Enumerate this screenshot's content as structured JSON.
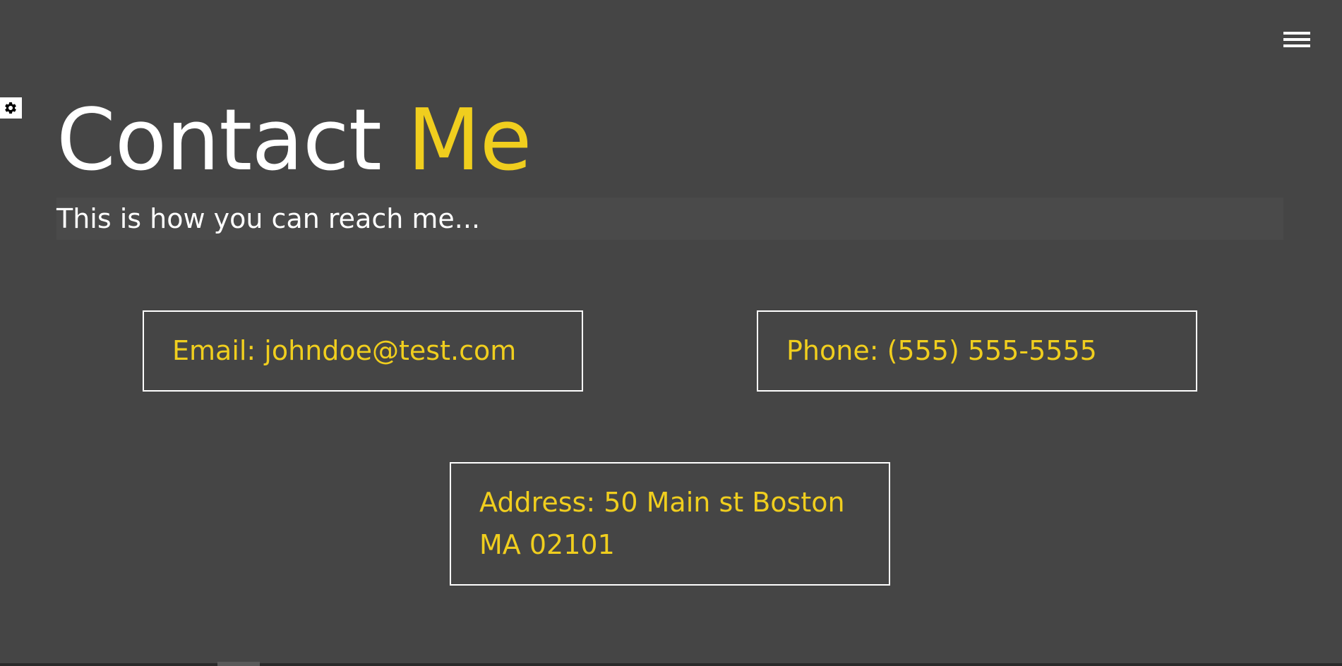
{
  "header": {
    "menu_icon": "hamburger-menu-icon",
    "settings_icon": "gear-icon"
  },
  "title": {
    "part1": "Contact",
    "part2": "Me"
  },
  "subtitle": "This is how you can reach me...",
  "contact": {
    "email": "Email: johndoe@test.com",
    "phone": "Phone: (555) 555-5555",
    "address_line1": "Address: 50 Main st Boston",
    "address_line2": "MA 02101"
  },
  "colors": {
    "background": "#454545",
    "accent": "#f0ce1e",
    "text": "#ffffff"
  }
}
